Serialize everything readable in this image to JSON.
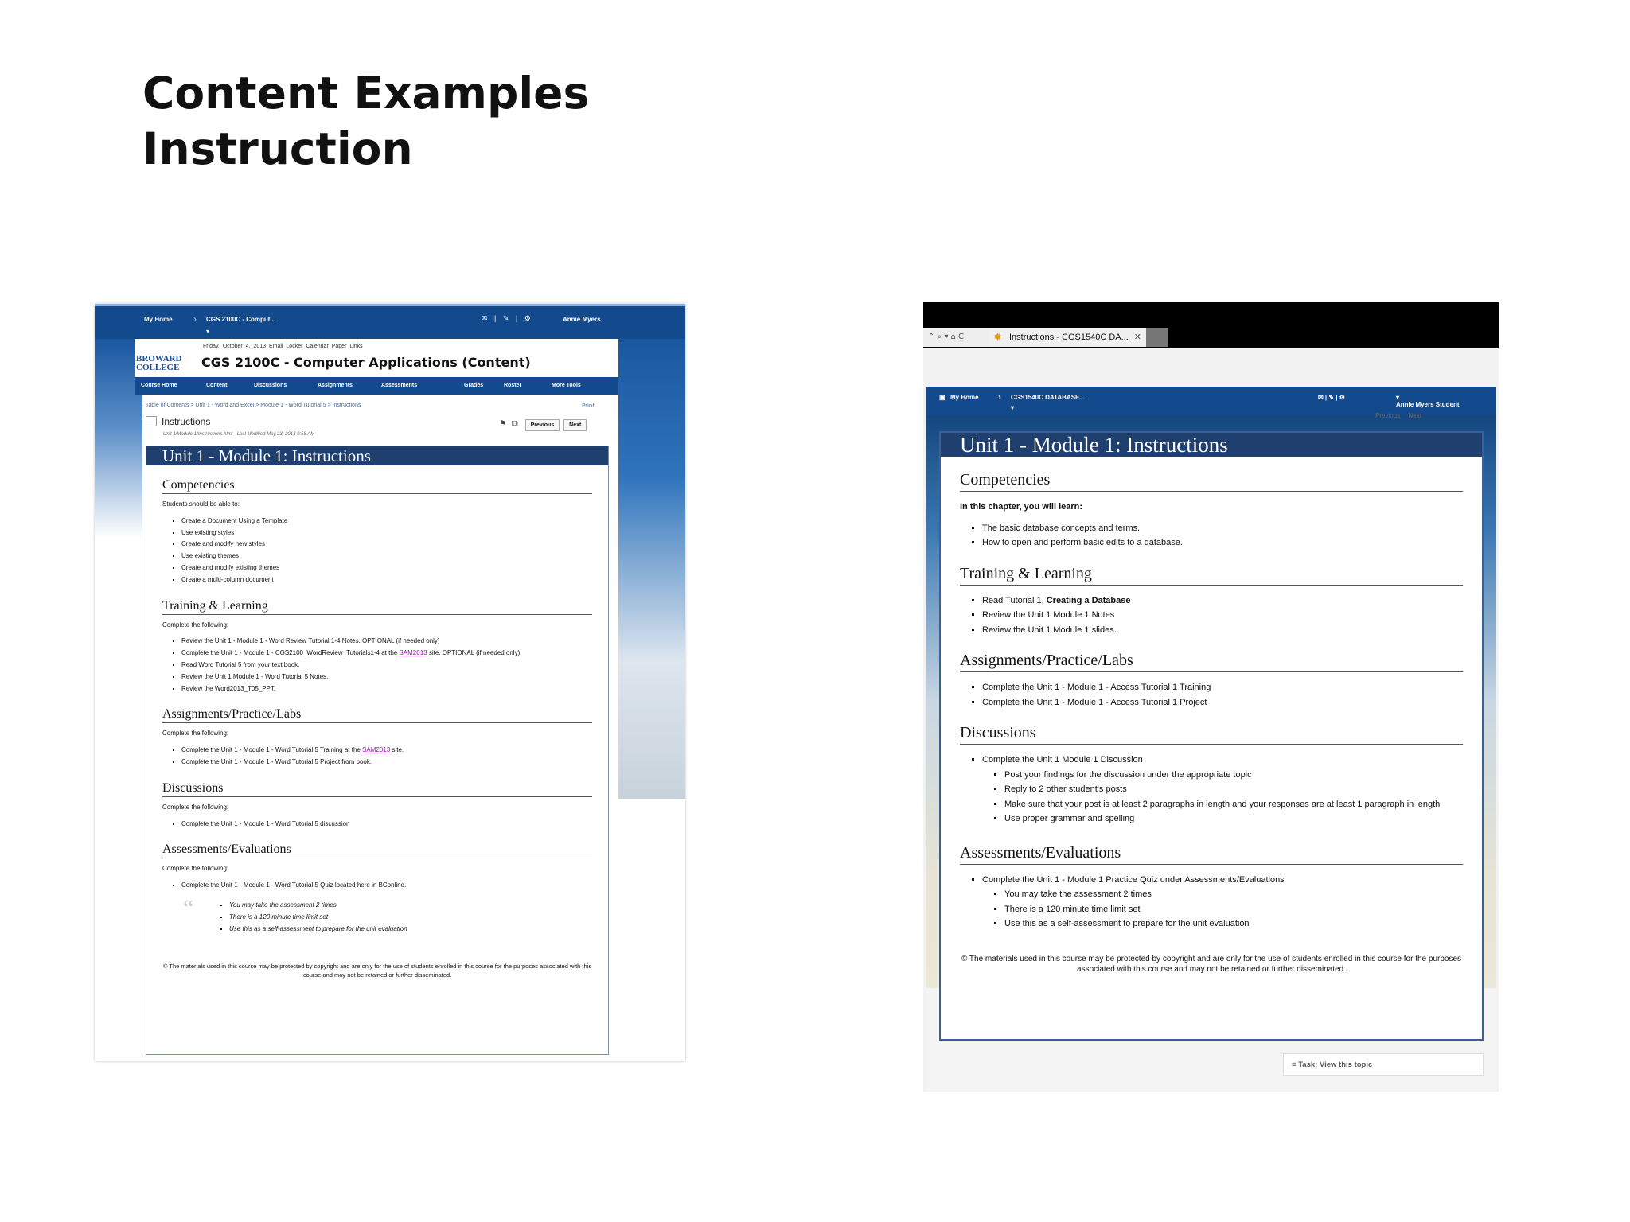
{
  "slide": {
    "title_line1": "Content Examples",
    "title_line2": "Instruction"
  },
  "shot1": {
    "topbar": {
      "home": "My Home",
      "course": "CGS 2100C - Comput...",
      "user": "Annie Myers"
    },
    "util_links": "Friday, October 4, 2013   Email   Locker   Calendar   Paper   Links",
    "logo": {
      "line1": "BROWARD",
      "line2": "COLLEGE"
    },
    "course_title": "CGS 2100C - Computer Applications (Content)",
    "nav": [
      "Course Home",
      "Content",
      "Discussions",
      "Assignments",
      "Assessments",
      "Grades",
      "Roster",
      "More Tools"
    ],
    "breadcrumbs": "Table of Contents  >  Unit 1 - Word and Excel  >  Module 1 - Word Tutorial 5  >  Instructions",
    "print": "Print",
    "topic_title": "Instructions",
    "file_path": "Unit 1/Module 1/Instructions.html - Last Modified May 23, 2013 9:58 AM",
    "prev": "Previous",
    "next": "Next",
    "banner": "Unit 1 - Module 1: Instructions",
    "competencies": {
      "heading": "Competencies",
      "intro": "Students should be able to:",
      "items": [
        "Create a Document Using a Template",
        "Use existing styles",
        "Create and modify new styles",
        "Use existing themes",
        "Create and modify existing themes",
        "Create a multi-column document"
      ]
    },
    "training": {
      "heading": "Training & Learning",
      "intro": "Complete the following:",
      "item1": "Review the Unit 1 - Module 1 - Word Review Tutorial 1-4 Notes. OPTIONAL (if needed only)",
      "item2_pre": "Complete the Unit 1 - Module 1 - CGS2100_WordReview_Tutorials1-4 at the ",
      "item2_link": "SAM2013",
      "item2_post": " site. OPTIONAL (if needed only)",
      "item3": "Read Word Tutorial 5 from your text book.",
      "item4": "Review the Unit 1 Module 1 - Word Tutorial 5 Notes.",
      "item5": "Review the Word2013_T05_PPT."
    },
    "assignments": {
      "heading": "Assignments/Practice/Labs",
      "intro": "Complete the following:",
      "item1_pre": "Complete the Unit 1 - Module 1 - Word Tutorial 5 Training at the ",
      "item1_link": "SAM2013",
      "item1_post": " site.",
      "item2": "Complete the Unit 1 - Module 1 - Word Tutorial 5 Project from book."
    },
    "discussions": {
      "heading": "Discussions",
      "intro": "Complete the following:",
      "items": [
        "Complete the Unit 1 - Module 1 - Word Tutorial 5 discussion"
      ]
    },
    "assessments": {
      "heading": "Assessments/Evaluations",
      "intro": "Complete the following:",
      "items": [
        "Complete the Unit 1 - Module 1 - Word Tutorial 5 Quiz located here in BConline."
      ],
      "quote_items": [
        "You may take the assessment 2 times",
        "There is a 120 minute time limit set",
        "Use this as a self-assessment to prepare for the unit evaluation"
      ]
    },
    "copyright": "© The materials used in this course may be protected by copyright and are only for the use of students enrolled in this course for the purposes associated with this course and may not be retained or further disseminated."
  },
  "shot2": {
    "addr": "⌃ ⌕ ▾ ⌂ C",
    "tab": "Instructions - CGS1540C DA...",
    "topbar": {
      "home": "My Home",
      "course": "CGS1540C DATABASE...",
      "user": "Annie Myers Student"
    },
    "prev": "Previous",
    "next": "Next",
    "banner": "Unit 1 - Module 1: Instructions",
    "competencies": {
      "heading": "Competencies",
      "intro": "In this chapter, you will learn:",
      "items": [
        "The basic database concepts and terms.",
        "How to open and perform basic edits to a database."
      ]
    },
    "training": {
      "heading": "Training & Learning",
      "item1_pre": "Read Tutorial 1, ",
      "item1_bold": "Creating a Database",
      "item2": "Review the Unit 1 Module 1 Notes",
      "item3": "Review the Unit 1 Module 1 slides."
    },
    "assignments": {
      "heading": "Assignments/Practice/Labs",
      "items": [
        "Complete the Unit 1 - Module 1 - Access Tutorial 1 Training",
        "Complete the Unit 1 - Module 1 - Access Tutorial 1 Project"
      ]
    },
    "discussions": {
      "heading": "Discussions",
      "item": "Complete the Unit 1 Module 1 Discussion",
      "sub": [
        "Post your findings for the discussion under the appropriate topic",
        "Reply to 2 other student's posts",
        "Make sure that your post is at least 2 paragraphs in length and your responses are at least 1 paragraph in length",
        "Use proper grammar and spelling"
      ]
    },
    "assessments": {
      "heading": "Assessments/Evaluations",
      "item": "Complete the Unit 1 - Module 1 Practice Quiz under Assessments/Evaluations",
      "sub": [
        "You may take the assessment 2 times",
        "There is a 120 minute time limit set",
        "Use this as a self-assessment to prepare for the unit evaluation"
      ]
    },
    "copyright": "© The materials used in this course may be protected by copyright and are only for the use of students enrolled in this course for the purposes associated with this course and may not be retained or further disseminated.",
    "task": "Task: View this topic"
  }
}
